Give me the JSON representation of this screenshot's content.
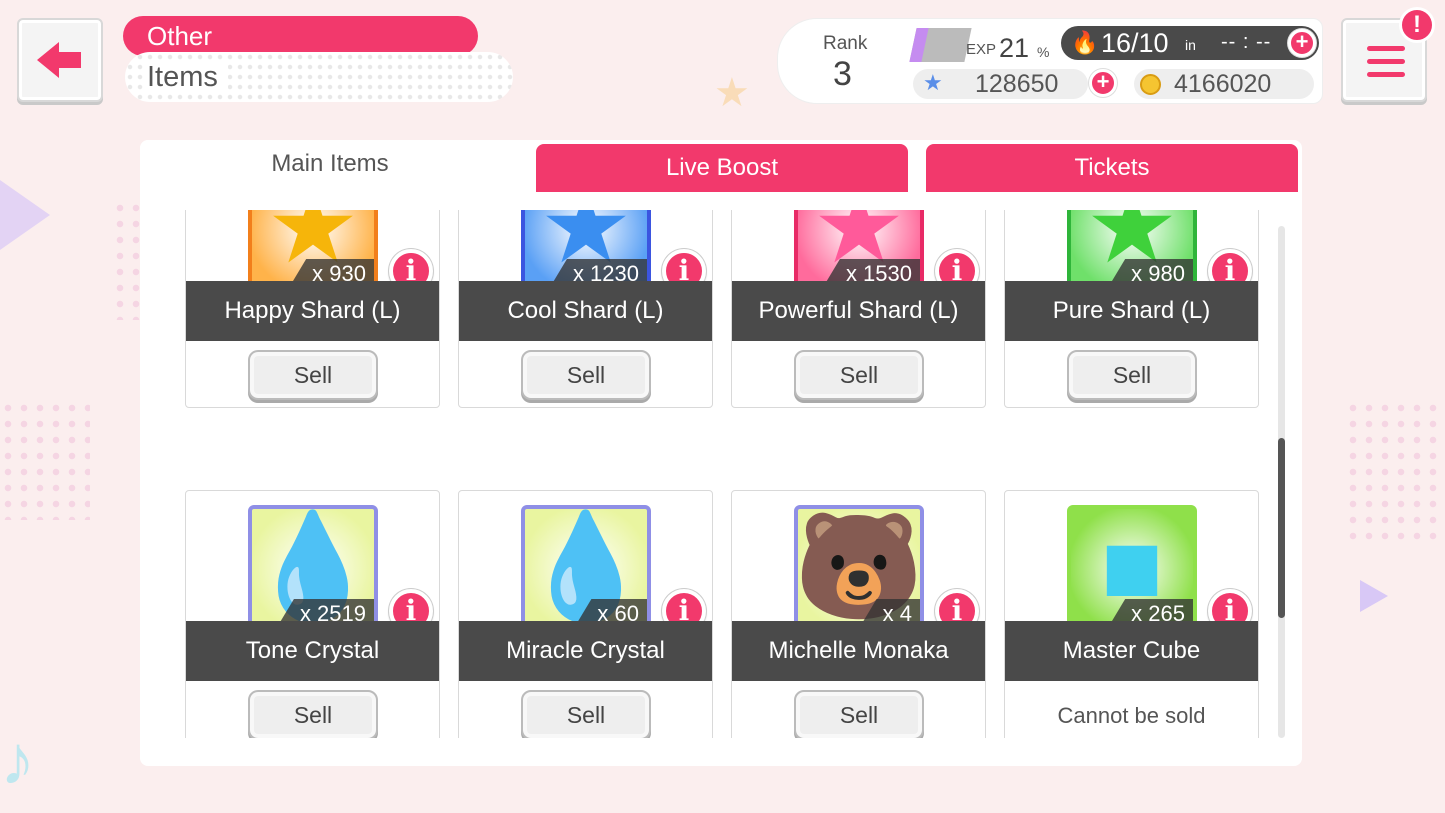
{
  "header": {
    "category": "Other",
    "title": "Items"
  },
  "status": {
    "rank_label": "Rank",
    "rank": "3",
    "exp_label": "EXP",
    "exp_value": "21",
    "exp_unit": "%",
    "stamina": "16/10",
    "stamina_in": "in",
    "stamina_timer": "-- : --",
    "star_gems": "128650",
    "coins": "4166020"
  },
  "tabs": [
    {
      "label": "Main Items",
      "active": true
    },
    {
      "label": "Live Boost",
      "active": false
    },
    {
      "label": "Tickets",
      "active": false
    }
  ],
  "items": [
    {
      "name": "Happy Shard (L)",
      "qty": "x 930",
      "action": "Sell",
      "icon": "star-shard-icon",
      "bg": "#ffb34a",
      "border": "#f27f1b",
      "glyph": "★",
      "glyph_color": "#f6b50a"
    },
    {
      "name": "Cool Shard (L)",
      "qty": "x 1230",
      "action": "Sell",
      "icon": "star-shard-icon",
      "bg": "#5aa0f5",
      "border": "#3b55e0",
      "glyph": "★",
      "glyph_color": "#3a8ef0"
    },
    {
      "name": "Powerful Shard (L)",
      "qty": "x 1530",
      "action": "Sell",
      "icon": "star-shard-icon",
      "bg": "#ff6b9c",
      "border": "#e82a66",
      "glyph": "★",
      "glyph_color": "#ff5a9a"
    },
    {
      "name": "Pure Shard (L)",
      "qty": "x 980",
      "action": "Sell",
      "icon": "star-shard-icon",
      "bg": "#6fe06a",
      "border": "#2fb53a",
      "glyph": "★",
      "glyph_color": "#3fd13b"
    },
    {
      "name": "Tone Crystal",
      "qty": "x 2519",
      "action": "Sell",
      "icon": "crystal-drop-icon",
      "bg": "#e9f5a0",
      "border": "#8f8fe6",
      "glyph": "💧",
      "glyph_color": "#b6a8f5"
    },
    {
      "name": "Miracle Crystal",
      "qty": "x 60",
      "action": "Sell",
      "icon": "crystal-drop-icon",
      "bg": "#e9f5a0",
      "border": "#8f8fe6",
      "glyph": "💧",
      "glyph_color": "#f59a9a"
    },
    {
      "name": "Michelle Monaka",
      "qty": "x 4",
      "action": "Sell",
      "icon": "bear-monaka-icon",
      "bg": "#e9f5a0",
      "border": "#8f8fe6",
      "glyph": "🐻",
      "glyph_color": "#d9a23a"
    },
    {
      "name": "Master Cube",
      "qty": "x 265",
      "action": "Cannot be sold",
      "icon": "cube-icon",
      "bg": "#8fe04a",
      "border": "#8fe04a",
      "glyph": "■",
      "glyph_color": "#3fd0f0"
    }
  ],
  "colors": {
    "accent": "#f2396c",
    "dark_bar": "#4a4a4a",
    "background": "#fbeeee"
  }
}
